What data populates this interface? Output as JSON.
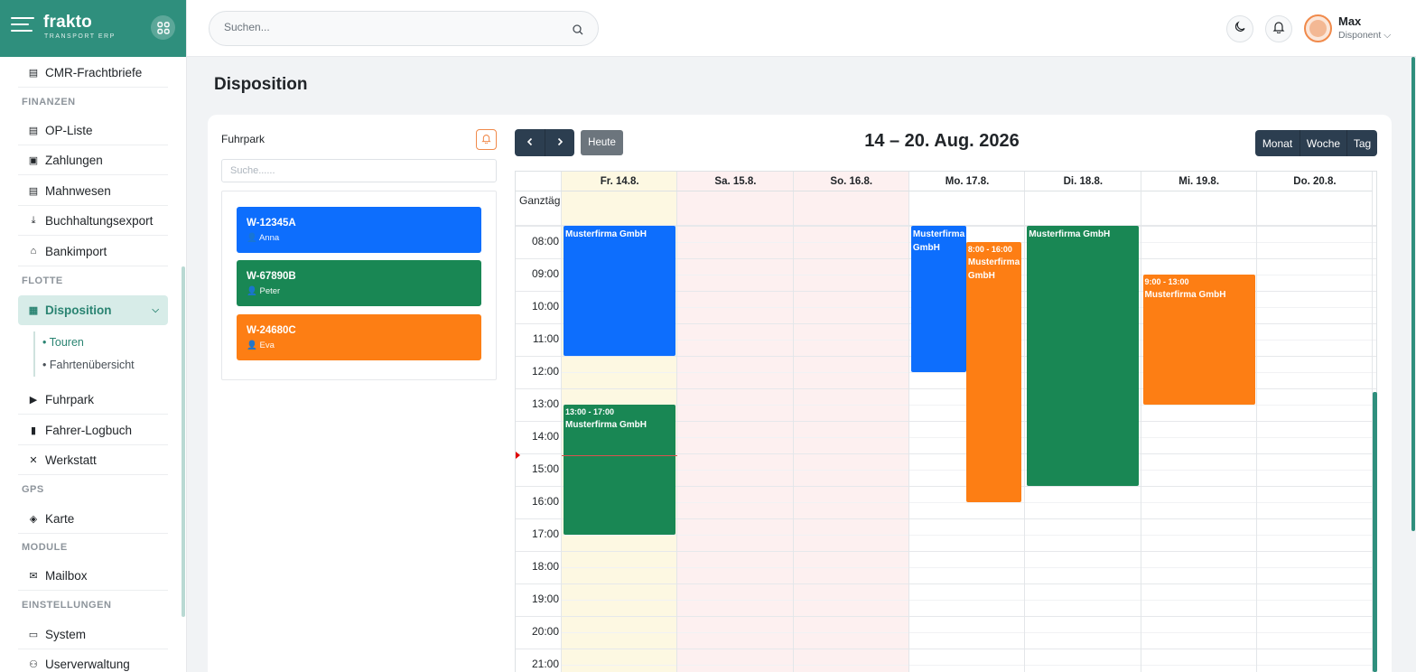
{
  "brand": {
    "name": "frakto",
    "subtitle": "TRANSPORT ERP"
  },
  "search": {
    "placeholder": "Suchen..."
  },
  "user": {
    "name": "Max",
    "role": "Disponent"
  },
  "sidebar": {
    "items": [
      {
        "label": "CMR-Frachtbriefe",
        "icon": "file-icon"
      },
      {
        "label": "OP-Liste",
        "icon": "file-icon"
      },
      {
        "label": "Zahlungen",
        "icon": "money-icon"
      },
      {
        "label": "Mahnwesen",
        "icon": "file-icon"
      },
      {
        "label": "Buchhaltungsexport",
        "icon": "download-icon"
      },
      {
        "label": "Bankimport",
        "icon": "bank-icon"
      },
      {
        "label": "Disposition",
        "icon": "calendar-icon"
      },
      {
        "label": "Fuhrpark",
        "icon": "truck-icon"
      },
      {
        "label": "Fahrer-Logbuch",
        "icon": "book-icon"
      },
      {
        "label": "Werkstatt",
        "icon": "tools-icon"
      },
      {
        "label": "Karte",
        "icon": "map-icon"
      },
      {
        "label": "Mailbox",
        "icon": "mail-icon"
      },
      {
        "label": "System",
        "icon": "monitor-icon"
      },
      {
        "label": "Userverwaltung",
        "icon": "users-icon"
      }
    ],
    "sections": [
      "FINANZEN",
      "FLOTTE",
      "GPS",
      "MODULE",
      "EINSTELLUNGEN"
    ],
    "subitems": [
      "Touren",
      "Fahrtenübersicht"
    ]
  },
  "page": {
    "title": "Disposition"
  },
  "fleet": {
    "title": "Fuhrpark",
    "search_placeholder": "Suche......",
    "vehicles": [
      {
        "plate": "W-12345A",
        "driver": "Anna",
        "color": "#0d6efd"
      },
      {
        "plate": "W-67890B",
        "driver": "Peter",
        "color": "#198754"
      },
      {
        "plate": "W-24680C",
        "driver": "Eva",
        "color": "#fd7e14"
      }
    ]
  },
  "calendar": {
    "title": "14 – 20. Aug. 2026",
    "today_label": "Heute",
    "views": [
      "Monat",
      "Woche",
      "Tag"
    ],
    "allday_label": "Ganztägig",
    "days": [
      {
        "label": "Fr. 14.8.",
        "type": "today"
      },
      {
        "label": "Sa. 15.8.",
        "type": "weekend"
      },
      {
        "label": "So. 16.8.",
        "type": "weekend"
      },
      {
        "label": "Mo. 17.8.",
        "type": "normal"
      },
      {
        "label": "Di. 18.8.",
        "type": "normal"
      },
      {
        "label": "Mi. 19.8.",
        "type": "normal"
      },
      {
        "label": "Do. 20.8.",
        "type": "normal"
      }
    ],
    "times": [
      "08:00",
      "09:00",
      "10:00",
      "11:00",
      "12:00",
      "13:00",
      "14:00",
      "15:00",
      "16:00",
      "17:00",
      "18:00",
      "19:00",
      "20:00",
      "21:00"
    ],
    "events": [
      {
        "day": 0,
        "start": 7.5,
        "end": 11.5,
        "time": "",
        "title": "Musterfirma GmbH",
        "color": "#0d6efd",
        "lane": "full"
      },
      {
        "day": 0,
        "start": 13,
        "end": 17,
        "time": "13:00 - 17:00",
        "title": "Musterfirma GmbH",
        "color": "#198754",
        "lane": "full"
      },
      {
        "day": 3,
        "start": 7.5,
        "end": 12,
        "time": "",
        "title": "Musterfirma GmbH",
        "color": "#0d6efd",
        "lane": "left"
      },
      {
        "day": 3,
        "start": 8,
        "end": 16,
        "time": "8:00 - 16:00",
        "title": "Musterfirma GmbH",
        "color": "#fd7e14",
        "lane": "right"
      },
      {
        "day": 4,
        "start": 7.5,
        "end": 15.5,
        "time": "",
        "title": "Musterfirma GmbH",
        "color": "#198754",
        "lane": "full"
      },
      {
        "day": 5,
        "start": 9,
        "end": 13,
        "time": "9:00 - 13:00",
        "title": "Musterfirma GmbH",
        "color": "#fd7e14",
        "lane": "full"
      }
    ],
    "now_hour": 14.55
  }
}
